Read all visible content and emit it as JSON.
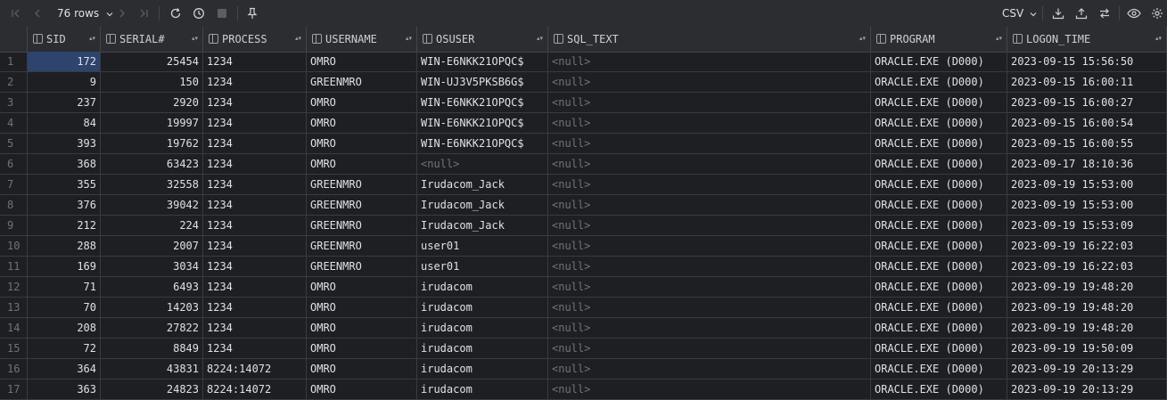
{
  "toolbar": {
    "rows_label": "76 rows",
    "export_format": "CSV"
  },
  "icons": {
    "first": "first-page-icon",
    "prev": "previous-page-icon",
    "next": "next-page-icon",
    "last": "last-page-icon",
    "reload": "reload-icon",
    "history": "history-icon",
    "stop": "stop-icon",
    "pin": "pin-icon",
    "download": "download-icon",
    "upload": "upload-icon",
    "compare": "compare-icon",
    "view": "eye-icon",
    "settings": "gear-icon"
  },
  "columns": [
    "SID",
    "SERIAL#",
    "PROCESS",
    "USERNAME",
    "OSUSER",
    "SQL_TEXT",
    "PROGRAM",
    "LOGON_TIME"
  ],
  "rows": [
    [
      "1",
      "172",
      "25454",
      "1234",
      "OMRO",
      "WIN-E6NKK21OPQC$",
      "<null>",
      "ORACLE.EXE (D000)",
      "2023-09-15 15:56:50"
    ],
    [
      "2",
      "9",
      "150",
      "1234",
      "GREENMRO",
      "WIN-UJ3V5PKSB6G$",
      "<null>",
      "ORACLE.EXE (D000)",
      "2023-09-15 16:00:11"
    ],
    [
      "3",
      "237",
      "2920",
      "1234",
      "OMRO",
      "WIN-E6NKK21OPQC$",
      "<null>",
      "ORACLE.EXE (D000)",
      "2023-09-15 16:00:27"
    ],
    [
      "4",
      "84",
      "19997",
      "1234",
      "OMRO",
      "WIN-E6NKK21OPQC$",
      "<null>",
      "ORACLE.EXE (D000)",
      "2023-09-15 16:00:54"
    ],
    [
      "5",
      "393",
      "19762",
      "1234",
      "OMRO",
      "WIN-E6NKK21OPQC$",
      "<null>",
      "ORACLE.EXE (D000)",
      "2023-09-15 16:00:55"
    ],
    [
      "6",
      "368",
      "63423",
      "1234",
      "OMRO",
      "<null>",
      "<null>",
      "ORACLE.EXE (D000)",
      "2023-09-17 18:10:36"
    ],
    [
      "7",
      "355",
      "32558",
      "1234",
      "GREENMRO",
      "Irudacom_Jack",
      "<null>",
      "ORACLE.EXE (D000)",
      "2023-09-19 15:53:00"
    ],
    [
      "8",
      "376",
      "39042",
      "1234",
      "GREENMRO",
      "Irudacom_Jack",
      "<null>",
      "ORACLE.EXE (D000)",
      "2023-09-19 15:53:00"
    ],
    [
      "9",
      "212",
      "224",
      "1234",
      "GREENMRO",
      "Irudacom_Jack",
      "<null>",
      "ORACLE.EXE (D000)",
      "2023-09-19 15:53:09"
    ],
    [
      "10",
      "288",
      "2007",
      "1234",
      "GREENMRO",
      "user01",
      "<null>",
      "ORACLE.EXE (D000)",
      "2023-09-19 16:22:03"
    ],
    [
      "11",
      "169",
      "3034",
      "1234",
      "GREENMRO",
      "user01",
      "<null>",
      "ORACLE.EXE (D000)",
      "2023-09-19 16:22:03"
    ],
    [
      "12",
      "71",
      "6493",
      "1234",
      "OMRO",
      "irudacom",
      "<null>",
      "ORACLE.EXE (D000)",
      "2023-09-19 19:48:20"
    ],
    [
      "13",
      "70",
      "14203",
      "1234",
      "OMRO",
      "irudacom",
      "<null>",
      "ORACLE.EXE (D000)",
      "2023-09-19 19:48:20"
    ],
    [
      "14",
      "208",
      "27822",
      "1234",
      "OMRO",
      "irudacom",
      "<null>",
      "ORACLE.EXE (D000)",
      "2023-09-19 19:48:20"
    ],
    [
      "15",
      "72",
      "8849",
      "1234",
      "OMRO",
      "irudacom",
      "<null>",
      "ORACLE.EXE (D000)",
      "2023-09-19 19:50:09"
    ],
    [
      "16",
      "364",
      "43831",
      "8224:14072",
      "OMRO",
      "irudacom",
      "<null>",
      "ORACLE.EXE (D000)",
      "2023-09-19 20:13:29"
    ],
    [
      "17",
      "363",
      "24823",
      "8224:14072",
      "OMRO",
      "irudacom",
      "<null>",
      "ORACLE.EXE (D000)",
      "2023-09-19 20:13:29"
    ]
  ]
}
